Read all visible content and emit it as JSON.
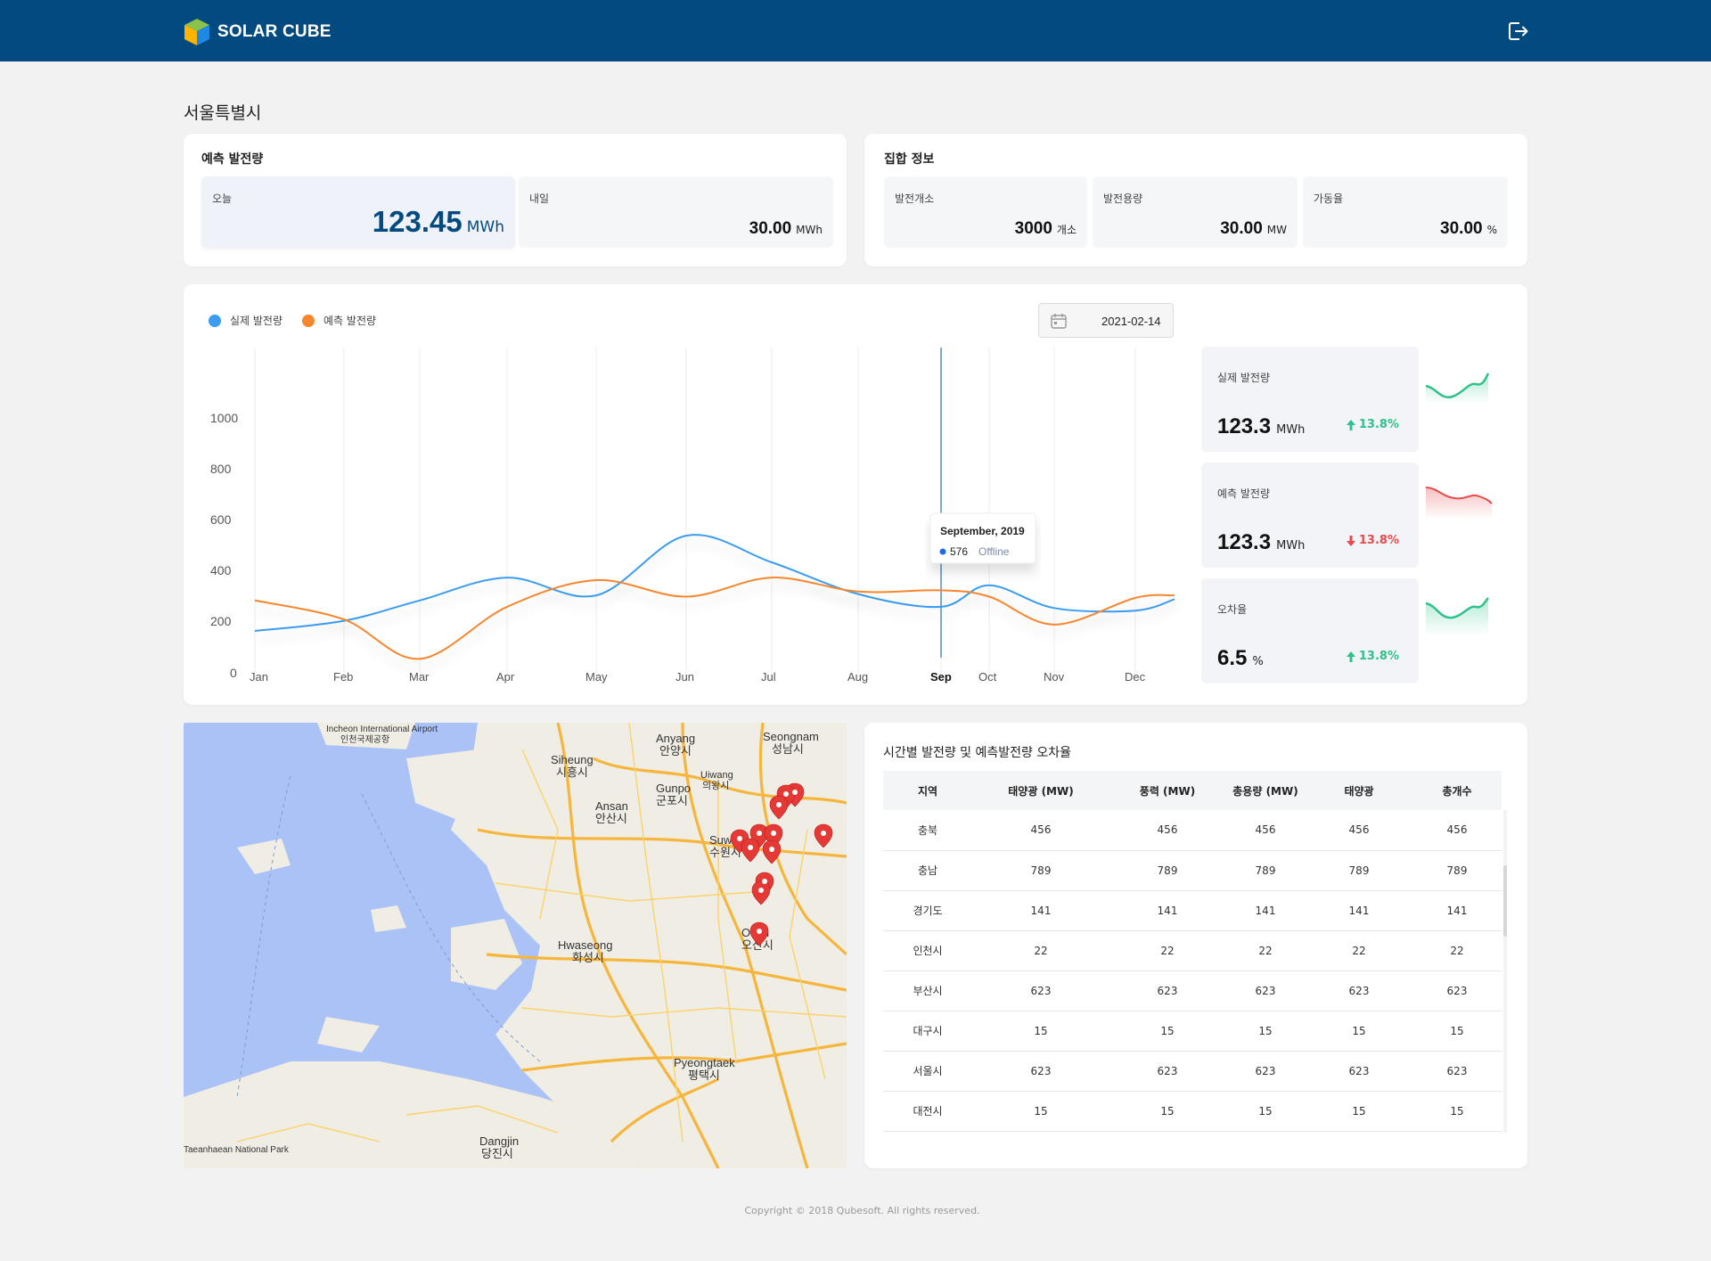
{
  "header": {
    "brand": "SOLAR CUBE",
    "brand_colors": {
      "top": "#8bc34a",
      "left": "#ffb300",
      "right": "#1e88e5"
    },
    "logout_icon": "logout-icon"
  },
  "region": {
    "title": "서울특별시"
  },
  "forecast": {
    "title": "예측 발전량",
    "today": {
      "label": "오늘",
      "value": "123.45",
      "unit": "MWh"
    },
    "tomorrow": {
      "label": "내일",
      "value": "30.00",
      "unit": "MWh"
    }
  },
  "aggregate": {
    "title": "집합 정보",
    "sites": {
      "label": "발전개소",
      "value": "3000",
      "unit": "개소"
    },
    "capacity": {
      "label": "발전용량",
      "value": "30.00",
      "unit": "MW"
    },
    "utilization": {
      "label": "가동율",
      "value": "30.00",
      "unit": "%"
    }
  },
  "chart_panel": {
    "legend": [
      {
        "label": "실제 발전량",
        "color": "#3b9cf0"
      },
      {
        "label": "예측 발전량",
        "color": "#f7862f"
      }
    ],
    "date": "2021-02-14",
    "tooltip": {
      "title": "September, 2019",
      "value": "576",
      "status": "Offline"
    }
  },
  "chart_data": {
    "type": "line",
    "x": [
      "Jan",
      "Feb",
      "Mar",
      "Apr",
      "May",
      "Jun",
      "Jul",
      "Aug",
      "Sep",
      "Oct",
      "Nov",
      "Dec"
    ],
    "highlighted_x": "Sep",
    "ylim": [
      0,
      1000
    ],
    "yticks": [
      0,
      200,
      400,
      600,
      800,
      1000
    ],
    "grid": "vertical",
    "series": [
      {
        "name": "실제 발전량",
        "color": "#3b9cf0",
        "values": [
          165,
          205,
          285,
          375,
          305,
          540,
          435,
          310,
          260,
          345,
          255,
          245
        ]
      },
      {
        "name": "예측 발전량",
        "color": "#f7862f",
        "values": [
          285,
          210,
          55,
          260,
          365,
          300,
          375,
          320,
          325,
          300,
          190,
          295
        ]
      }
    ]
  },
  "stats": [
    {
      "label": "실제 발전량",
      "value": "123.3",
      "unit": "MWh",
      "change": "13.8%",
      "direction": "up",
      "color": "#2ec28a"
    },
    {
      "label": "예측 발전량",
      "value": "123.3",
      "unit": "MWh",
      "change": "13.8%",
      "direction": "down",
      "color": "#e84a4a"
    },
    {
      "label": "오차율",
      "value": "6.5",
      "unit": "%",
      "change": "13.8%",
      "direction": "up",
      "color": "#2ec28a"
    }
  ],
  "map": {
    "labels": [
      {
        "text": "Incheon International Airport"
      },
      {
        "text": "인천국제공항"
      },
      {
        "text": "Anyang"
      },
      {
        "text": "안양시"
      },
      {
        "text": "Seongnam"
      },
      {
        "text": "성남시"
      },
      {
        "text": "Siheung"
      },
      {
        "text": "시흥시"
      },
      {
        "text": "Uiwang"
      },
      {
        "text": "의왕시"
      },
      {
        "text": "Gunpo"
      },
      {
        "text": "군포시"
      },
      {
        "text": "Ansan"
      },
      {
        "text": "안산시"
      },
      {
        "text": "Suwon"
      },
      {
        "text": "수원시"
      },
      {
        "text": "Osan"
      },
      {
        "text": "오산시"
      },
      {
        "text": "Hwaseong"
      },
      {
        "text": "화성시"
      },
      {
        "text": "Pyeongtaek"
      },
      {
        "text": "평택시"
      },
      {
        "text": "Dangjin"
      },
      {
        "text": "당진시"
      },
      {
        "text": "Taeanhaean National Park"
      }
    ]
  },
  "table": {
    "title": "시간별 발전량 및 예측발전량 오차율",
    "columns": [
      "지역",
      "태양광 (MW)",
      "풍력 (MW)",
      "총용량 (MW)",
      "태양광",
      "총개수"
    ],
    "rows": [
      [
        "충북",
        "456",
        "456",
        "456",
        "456",
        "456"
      ],
      [
        "충남",
        "789",
        "789",
        "789",
        "789",
        "789"
      ],
      [
        "경기도",
        "141",
        "141",
        "141",
        "141",
        "141"
      ],
      [
        "인천시",
        "22",
        "22",
        "22",
        "22",
        "22"
      ],
      [
        "부산시",
        "623",
        "623",
        "623",
        "623",
        "623"
      ],
      [
        "대구시",
        "15",
        "15",
        "15",
        "15",
        "15"
      ],
      [
        "서울시",
        "623",
        "623",
        "623",
        "623",
        "623"
      ],
      [
        "대전시",
        "15",
        "15",
        "15",
        "15",
        "15"
      ]
    ]
  },
  "footer": {
    "copyright": "Copyright © 2018 Qubesoft. All rights reserved."
  }
}
